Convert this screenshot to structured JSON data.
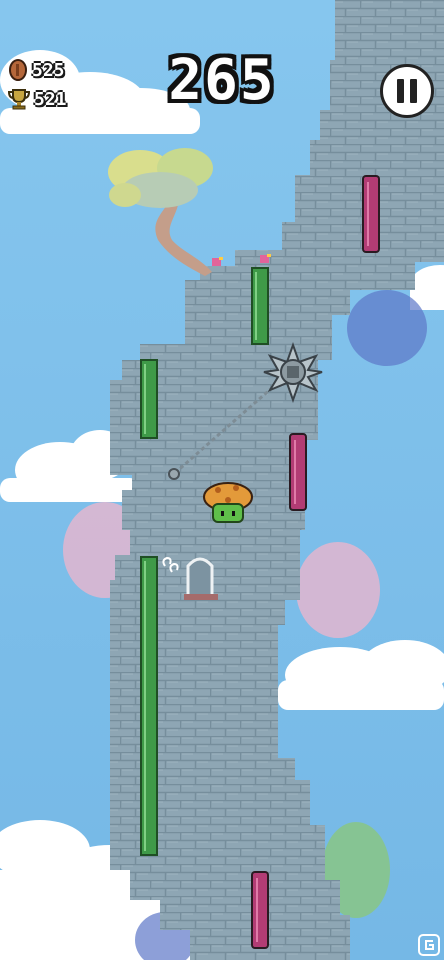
{
  "hud": {
    "score": "265",
    "coins": "525",
    "best": "521"
  },
  "icons": {
    "coin": "coin-icon",
    "best": "trophy-icon",
    "pause": "pause-icon"
  },
  "colors": {
    "sky": "#7fc1ec",
    "tower": "#8ea6b4",
    "green_platform": "#3f9a48",
    "pink_platform": "#b23c74",
    "player_cap": "#e39a3a",
    "player_body": "#5fbf4a"
  }
}
